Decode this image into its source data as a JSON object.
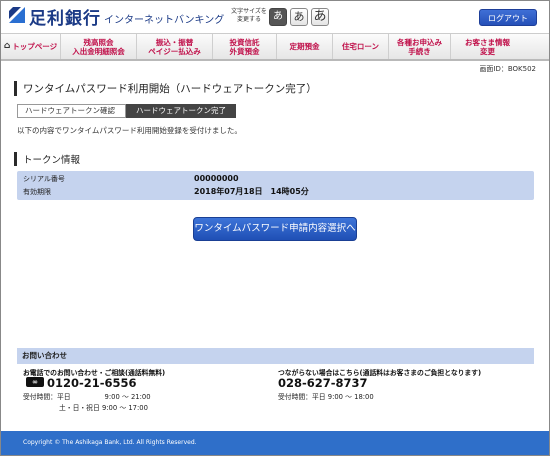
{
  "header": {
    "brand": "足利銀行",
    "service": "インターネットバンキング",
    "font_size_label": "文字サイズを\n変更する",
    "font_size_options": [
      "あ",
      "あ",
      "あ"
    ],
    "logout": "ログアウト",
    "brand_color": "#1b3a86"
  },
  "nav": {
    "items": [
      {
        "label": "トップページ",
        "icon": "home-icon"
      },
      {
        "label": "残高照会\n入出金明細照会"
      },
      {
        "label": "振込・振替\nペイジー払込み"
      },
      {
        "label": "投資信託\n外貨預金"
      },
      {
        "label": "定期預金"
      },
      {
        "label": "住宅ローン"
      },
      {
        "label": "各種お申込み\n手続き"
      },
      {
        "label": "お客さま情報\n変更"
      }
    ],
    "accent_color": "#c0104a"
  },
  "screen_id": "画面ID：BOK502",
  "main": {
    "title": "ワンタイムパスワード利用開始（ハードウェアトークン完了）",
    "steps": [
      "ハードウェアトークン確認",
      "ハードウェアトークン完了"
    ],
    "intro": "以下の内容でワンタイムパスワード利用開始登録を受付けました。",
    "token_section_title": "トークン情報",
    "token_rows": [
      {
        "label": "シリアル番号",
        "value": "00000000"
      },
      {
        "label": "有効期限",
        "value": "2018年07月18日　14時05分"
      }
    ],
    "action_button": "ワンタイムパスワード申請内容選択へ"
  },
  "contact": {
    "heading": "お問い合わせ",
    "phone_label": "お電話でのお問い合わせ・ご相談(通話料無料)",
    "phone_number": "0120-21-6556",
    "hours_weekday": "受付時間：平日　　　　　9:00 ～ 21:00",
    "hours_weekend": "土・日・祝日  9:00 ～ 17:00",
    "alt_label": "つながらない場合はこちら(通話料はお客さまのご負担となります)",
    "alt_number": "028-627-8737",
    "alt_hours": "受付時間：平日 9:00 ～ 18:00"
  },
  "footer": {
    "copyright": "Copyright © The Ashikaga Bank, Ltd. All Rights Reserved."
  }
}
